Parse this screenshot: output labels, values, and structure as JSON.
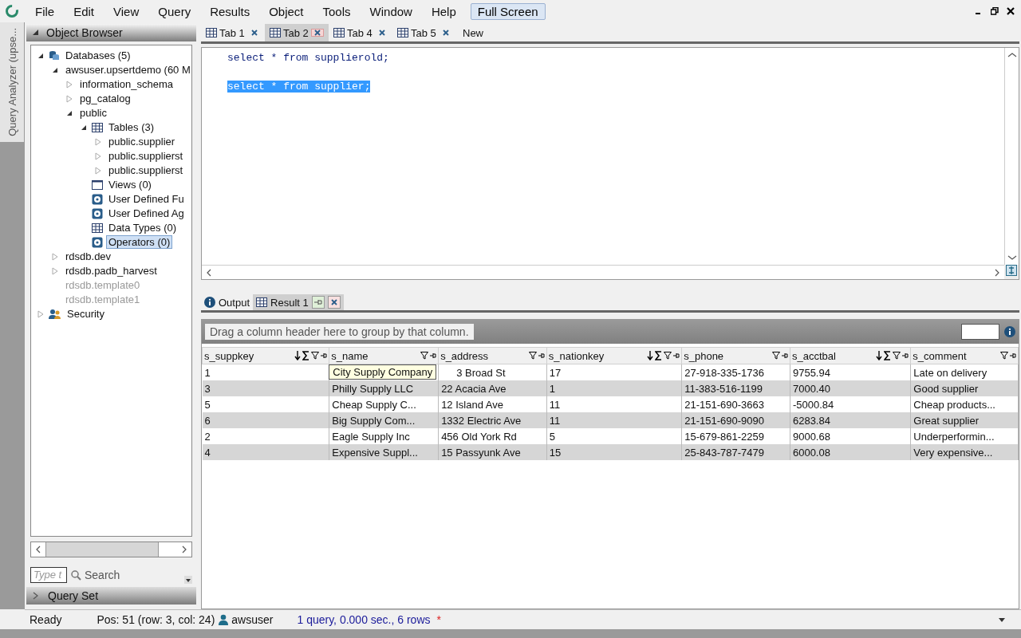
{
  "menu": [
    {
      "label": "File",
      "kind": "menu"
    },
    {
      "label": "Edit",
      "kind": "menu"
    },
    {
      "label": "View",
      "kind": "menu"
    },
    {
      "label": "Query",
      "kind": "menu"
    },
    {
      "label": "Results",
      "kind": "menu"
    },
    {
      "label": "Object",
      "kind": "menu"
    },
    {
      "label": "Tools",
      "kind": "menu"
    },
    {
      "label": "Window",
      "kind": "menu"
    },
    {
      "label": "Help",
      "kind": "menu"
    },
    {
      "label": "Full Screen",
      "kind": "button"
    }
  ],
  "side_tab": "Query Analyzer (upse...",
  "object_browser": {
    "title": "Object Browser",
    "tree": [
      {
        "label": "Databases (5)",
        "kind": "databases",
        "expanded": true,
        "selected": false,
        "disabled": false,
        "children": [
          {
            "label": "awsuser.upsertdemo (60 M",
            "expanded": true,
            "selected": false,
            "disabled": false,
            "children": [
              {
                "label": "information_schema",
                "expanded": false,
                "selected": false,
                "disabled": false
              },
              {
                "label": "pg_catalog",
                "expanded": false,
                "selected": false,
                "disabled": false
              },
              {
                "label": "public",
                "expanded": true,
                "selected": false,
                "disabled": false,
                "children": [
                  {
                    "label": "Tables (3)",
                    "kind": "tables",
                    "expanded": true,
                    "selected": false,
                    "disabled": false,
                    "children": [
                      {
                        "label": "public.supplier",
                        "expanded": false,
                        "selected": false,
                        "disabled": false
                      },
                      {
                        "label": "public.supplierst",
                        "expanded": false,
                        "selected": false,
                        "disabled": false
                      },
                      {
                        "label": "public.supplierst",
                        "expanded": false,
                        "selected": false,
                        "disabled": false
                      }
                    ]
                  },
                  {
                    "label": "Views (0)",
                    "kind": "views",
                    "selected": false,
                    "disabled": false
                  },
                  {
                    "label": "User Defined Fu",
                    "kind": "gear",
                    "selected": false,
                    "disabled": false
                  },
                  {
                    "label": "User Defined Ag",
                    "kind": "gear",
                    "selected": false,
                    "disabled": false
                  },
                  {
                    "label": "Data Types (0)",
                    "kind": "tables",
                    "selected": false,
                    "disabled": false
                  },
                  {
                    "label": "Operators (0)",
                    "kind": "gear",
                    "selected": true,
                    "disabled": false
                  }
                ]
              }
            ]
          },
          {
            "label": "rdsdb.dev",
            "expanded": false,
            "selected": false,
            "disabled": false
          },
          {
            "label": "rdsdb.padb_harvest",
            "expanded": false,
            "selected": false,
            "disabled": false
          },
          {
            "label": "rdsdb.template0",
            "selected": false,
            "disabled": true
          },
          {
            "label": "rdsdb.template1",
            "selected": false,
            "disabled": true
          }
        ]
      },
      {
        "label": "Security",
        "kind": "users",
        "expanded": false,
        "selected": false,
        "disabled": false
      }
    ],
    "filter": {
      "placeholder": "Type t"
    },
    "search_button": "Search",
    "query_set": "Query Set"
  },
  "doc_tabs": [
    {
      "label": "Tab 1",
      "kind": "tab",
      "selected": false
    },
    {
      "label": "Tab 2",
      "kind": "tab",
      "selected": true
    },
    {
      "label": "Tab 4",
      "kind": "tab",
      "selected": false
    },
    {
      "label": "Tab 5",
      "kind": "tab",
      "selected": false
    },
    {
      "label": "New",
      "kind": "new",
      "selected": false
    }
  ],
  "editor": {
    "lines": [
      {
        "text": "select * from supplierold;",
        "selected": false
      },
      {
        "text": "select * from supplier;",
        "selected": true
      }
    ]
  },
  "result_tabs": [
    {
      "label": "Output",
      "kind": "info",
      "selected": false
    },
    {
      "label": "Result 1",
      "kind": "grid",
      "selected": true
    }
  ],
  "grid": {
    "group_hint": "Drag a column header here to group by that column.",
    "columns": [
      {
        "label": "s_suppkey",
        "kind": "numeric"
      },
      {
        "label": "s_name",
        "kind": "text"
      },
      {
        "label": "s_address",
        "kind": "text"
      },
      {
        "label": "s_nationkey",
        "kind": "numeric"
      },
      {
        "label": "s_phone",
        "kind": "text"
      },
      {
        "label": "s_acctbal",
        "kind": "numeric"
      },
      {
        "label": "s_comment",
        "kind": "text"
      }
    ],
    "rows": [
      {
        "cells": [
          "1",
          "City Supply Company",
          "3 Broad St",
          "17",
          "27-918-335-1736",
          "9755.94",
          "Late on delivery"
        ],
        "tooltip": true
      },
      {
        "cells": [
          "3",
          "Philly Supply LLC",
          "22 Acacia Ave",
          "1",
          "11-383-516-1199",
          "7000.40",
          "Good supplier"
        ],
        "tooltip": false
      },
      {
        "cells": [
          "5",
          "Cheap Supply C...",
          "12 Island Ave",
          "11",
          "21-151-690-3663",
          "-5000.84",
          "Cheap products..."
        ],
        "tooltip": false
      },
      {
        "cells": [
          "6",
          "Big Supply Com...",
          "1332 Electric Ave",
          "11",
          "21-151-690-9090",
          "6283.84",
          "Great supplier"
        ],
        "tooltip": false
      },
      {
        "cells": [
          "2",
          "Eagle Supply Inc",
          "456 Old York Rd",
          "5",
          "15-679-861-2259",
          "9000.68",
          "Underperformin..."
        ],
        "tooltip": false
      },
      {
        "cells": [
          "4",
          "Expensive Suppl...",
          "15 Passyunk Ave",
          "15",
          "25-843-787-7479",
          "6000.08",
          "Very expensive..."
        ],
        "tooltip": false
      }
    ]
  },
  "status_bar": {
    "state": "Ready",
    "position": "Pos: 51 (row: 3, col: 24)",
    "user": "awsuser",
    "summary": "1 query, 0.000 sec., 6 rows",
    "modified": "*"
  }
}
